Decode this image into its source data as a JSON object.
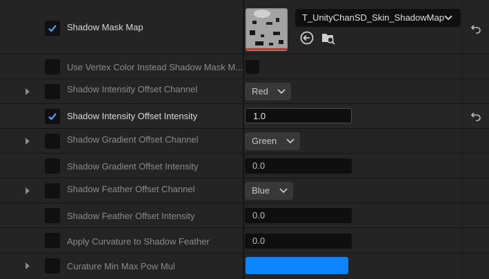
{
  "properties": [
    {
      "label": "Shadow Mask Map",
      "checked": true,
      "enabled": true
    },
    {
      "label": "Use Vertex Color Instead Shadow Mask M...",
      "checked": false,
      "enabled": false
    },
    {
      "label": "Shadow Intensity Offset Channel",
      "checked": false,
      "enabled": false
    },
    {
      "label": "Shadow Intensity Offset Intensity",
      "checked": true,
      "enabled": true
    },
    {
      "label": "Shadow Gradient Offset Channel",
      "checked": false,
      "enabled": false
    },
    {
      "label": "Shadow Gradient Offset Intensity",
      "checked": false,
      "enabled": false
    },
    {
      "label": "Shadow Feather Offset Channel",
      "checked": false,
      "enabled": false
    },
    {
      "label": "Shadow Feather Offset Intensity",
      "checked": false,
      "enabled": false
    },
    {
      "label": "Apply Curvature to Shadow Feather",
      "checked": false,
      "enabled": false
    },
    {
      "label": "Curature Min Max Pow Mul",
      "checked": false,
      "enabled": false
    }
  ],
  "values": {
    "texture_asset": "T_UnityChanSD_Skin_ShadowMap",
    "intensity_channel": "Red",
    "intensity_value": "1.0",
    "gradient_channel": "Green",
    "gradient_value": "0.0",
    "feather_channel": "Blue",
    "feather_value": "0.0",
    "curvature_value": "0.0",
    "curature_color": "#0a84ff"
  },
  "icons": {
    "checkmark": "checkmark-icon",
    "reset": "reset-to-default-icon",
    "expander": "chevron-right-icon",
    "dropdown": "chevron-down-icon",
    "use_selected": "use-selected-asset-icon",
    "browse": "browse-to-asset-icon"
  },
  "colors": {
    "check": "#4aa3ff",
    "accent": "#0a84ff"
  }
}
